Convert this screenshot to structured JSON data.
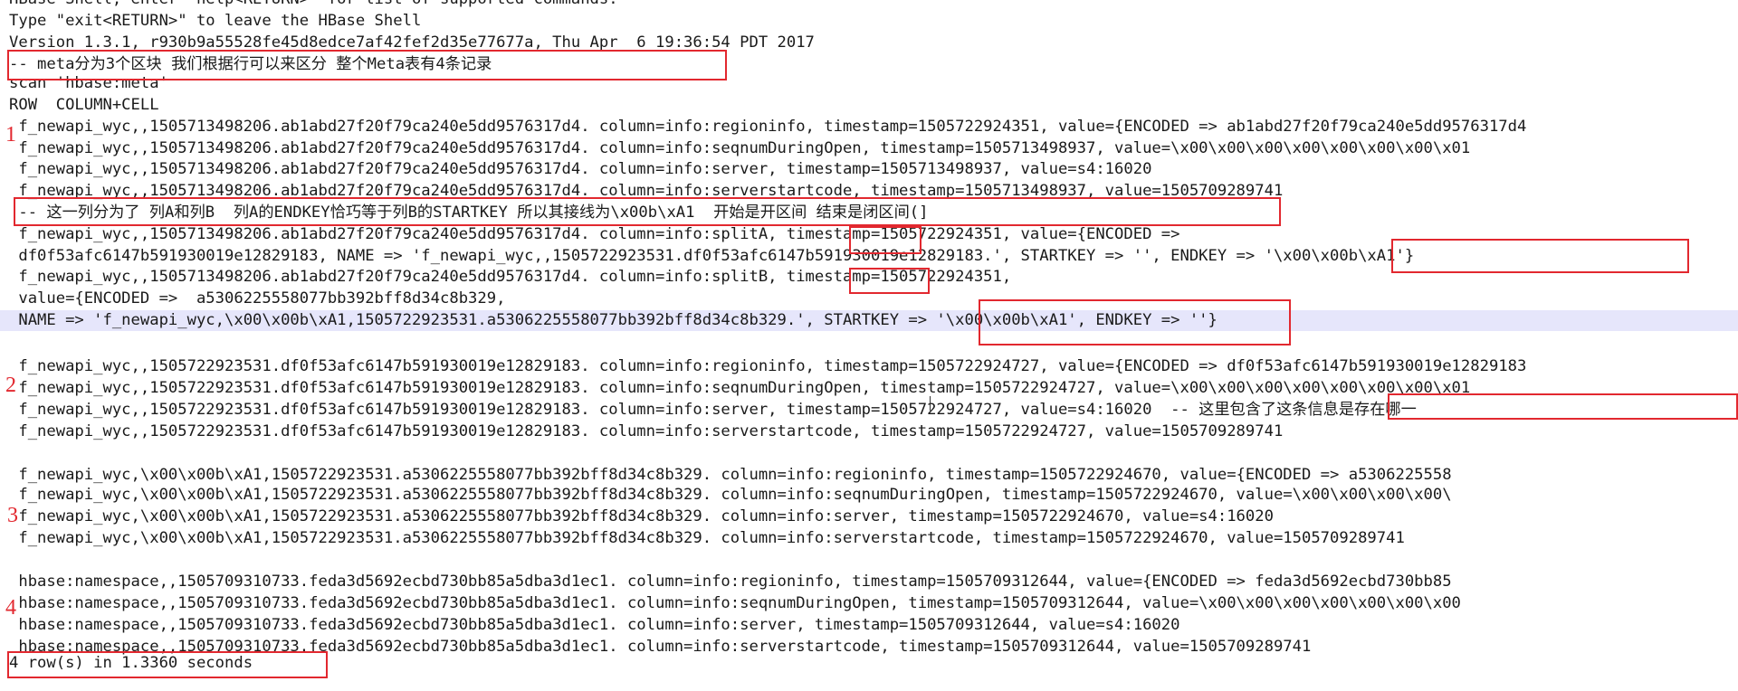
{
  "terminal": {
    "lines": [
      "HBase Shell; enter 'help<RETURN>' for list of supported commands.",
      "Type \"exit<RETURN>\" to leave the HBase Shell",
      "Version 1.3.1, r930b9a55528fe45d8edce7af42fef2d35e77677a, Thu Apr  6 19:36:54 PDT 2017",
      "-- meta分为3个区块 我们根据行可以来区分 整个Meta表有4条记录",
      "scan 'hbase:meta'",
      "ROW  COLUMN+CELL",
      " f_newapi_wyc,,1505713498206.ab1abd27f20f79ca240e5dd9576317d4. column=info:regioninfo, timestamp=1505722924351, value={ENCODED => ab1abd27f20f79ca240e5dd9576317d4",
      " f_newapi_wyc,,1505713498206.ab1abd27f20f79ca240e5dd9576317d4. column=info:seqnumDuringOpen, timestamp=1505713498937, value=\\x00\\x00\\x00\\x00\\x00\\x00\\x00\\x01",
      " f_newapi_wyc,,1505713498206.ab1abd27f20f79ca240e5dd9576317d4. column=info:server, timestamp=1505713498937, value=s4:16020",
      " f_newapi_wyc,,1505713498206.ab1abd27f20f79ca240e5dd9576317d4. column=info:serverstartcode, timestamp=1505713498937, value=1505709289741",
      " -- 这一列分为了 列A和列B  列A的ENDKEY恰巧等于列B的STARTKEY 所以其接线为\\x00b\\xA1  开始是开区间 结束是闭区间(]",
      " f_newapi_wyc,,1505713498206.ab1abd27f20f79ca240e5dd9576317d4. column=info:splitA, timestamp=1505722924351, value={ENCODED =>",
      " df0f53afc6147b591930019e12829183, NAME => 'f_newapi_wyc,,1505722923531.df0f53afc6147b591930019e12829183.', STARTKEY => '', ENDKEY => '\\x00\\x00b\\xA1'}",
      " f_newapi_wyc,,1505713498206.ab1abd27f20f79ca240e5dd9576317d4. column=info:splitB, timestamp=1505722924351,",
      " value={ENCODED =>  a5306225558077bb392bff8d34c8b329,",
      " NAME => 'f_newapi_wyc,\\x00\\x00b\\xA1,1505722923531.a5306225558077bb392bff8d34c8b329.', STARTKEY => '\\x00\\x00b\\xA1', ENDKEY => ''}",
      "",
      " f_newapi_wyc,,1505722923531.df0f53afc6147b591930019e12829183. column=info:regioninfo, timestamp=1505722924727, value={ENCODED => df0f53afc6147b591930019e12829183",
      " f_newapi_wyc,,1505722923531.df0f53afc6147b591930019e12829183. column=info:seqnumDuringOpen, timestamp=1505722924727, value=\\x00\\x00\\x00\\x00\\x00\\x00\\x00\\x01",
      " f_newapi_wyc,,1505722923531.df0f53afc6147b591930019e12829183. column=info:server, timestamp=1505722924727, value=s4:16020  -- 这里包含了这条信息是存在哪一",
      " f_newapi_wyc,,1505722923531.df0f53afc6147b591930019e12829183. column=info:serverstartcode, timestamp=1505722924727, value=1505709289741",
      "",
      " f_newapi_wyc,\\x00\\x00b\\xA1,1505722923531.a5306225558077bb392bff8d34c8b329. column=info:regioninfo, timestamp=1505722924670, value={ENCODED => a5306225558",
      " f_newapi_wyc,\\x00\\x00b\\xA1,1505722923531.a5306225558077bb392bff8d34c8b329. column=info:seqnumDuringOpen, timestamp=1505722924670, value=\\x00\\x00\\x00\\x00\\",
      " f_newapi_wyc,\\x00\\x00b\\xA1,1505722923531.a5306225558077bb392bff8d34c8b329. column=info:server, timestamp=1505722924670, value=s4:16020",
      " f_newapi_wyc,\\x00\\x00b\\xA1,1505722923531.a5306225558077bb392bff8d34c8b329. column=info:serverstartcode, timestamp=1505722924670, value=1505709289741",
      "",
      " hbase:namespace,,1505709310733.feda3d5692ecbd730bb85a5dba3d1ec1. column=info:regioninfo, timestamp=1505709312644, value={ENCODED => feda3d5692ecbd730bb85",
      " hbase:namespace,,1505709310733.feda3d5692ecbd730bb85a5dba3d1ec1. column=info:seqnumDuringOpen, timestamp=1505709312644, value=\\x00\\x00\\x00\\x00\\x00\\x00\\x00",
      " hbase:namespace,,1505709310733.feda3d5692ecbd730bb85a5dba3d1ec1. column=info:server, timestamp=1505709312644, value=s4:16020",
      " hbase:namespace,,1505709310733.feda3d5692ecbd730bb85a5dba3d1ec1. column=info:serverstartcode, timestamp=1505709312644, value=1505709289741",
      "4 row(s) in 1.3360 seconds"
    ]
  },
  "section_numbers": [
    "1",
    "2",
    "3",
    "4"
  ],
  "colors": {
    "annotation": "#e2282f",
    "highlight": "#e6e6fb",
    "text": "#1a1a1a",
    "background": "#ffffff"
  }
}
